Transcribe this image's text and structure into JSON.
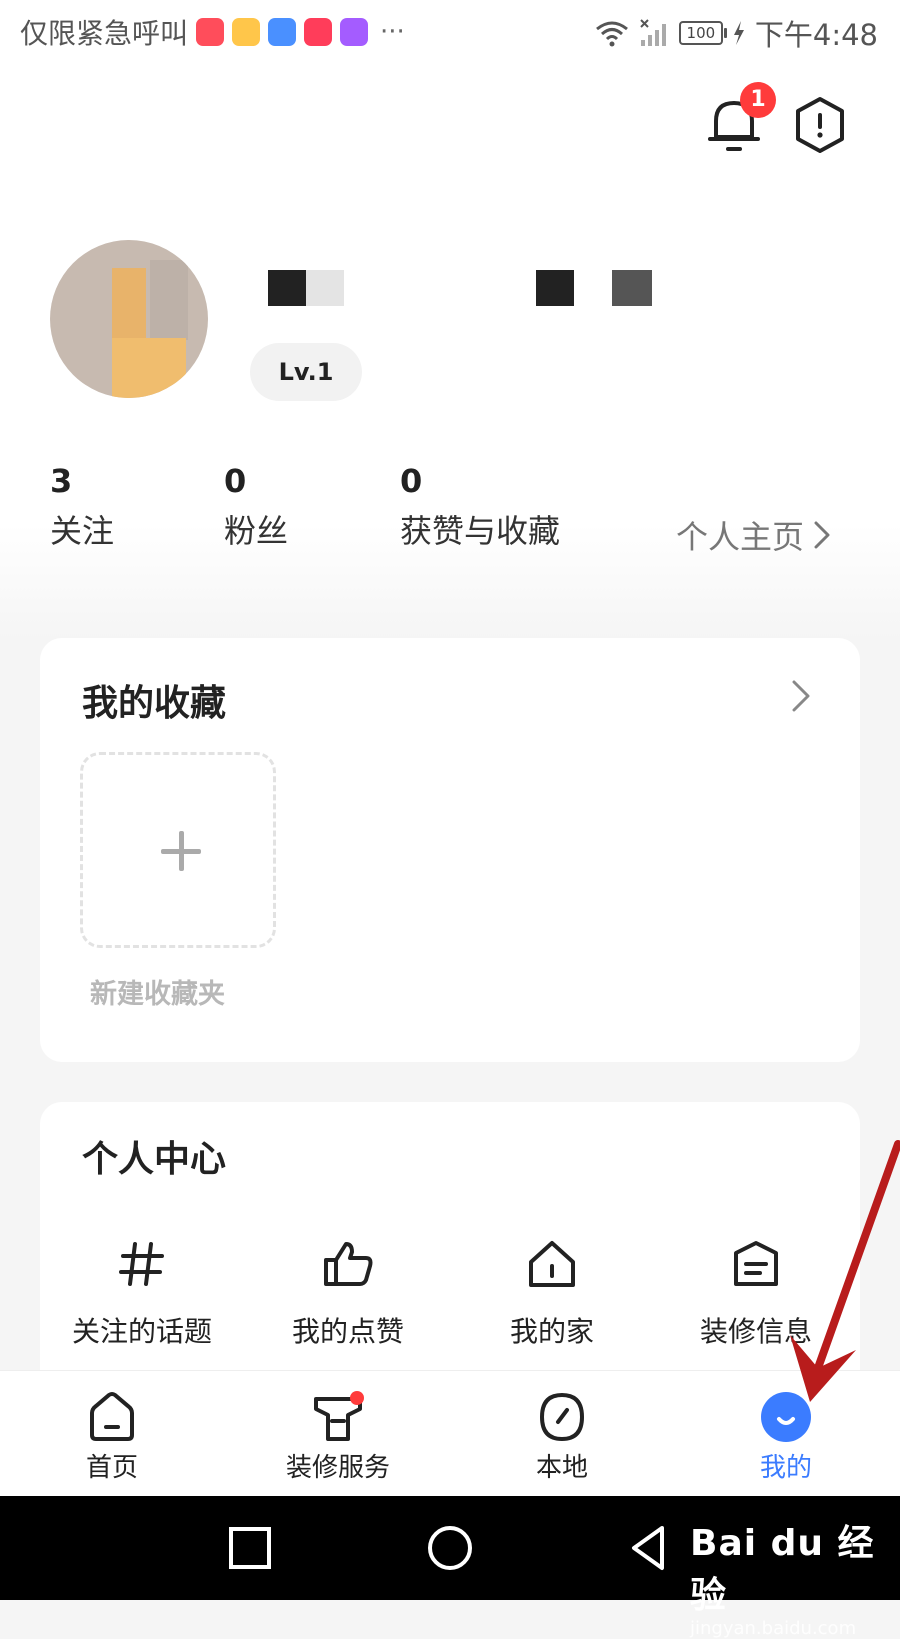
{
  "status_bar": {
    "carrier_text": "仅限紧急呼叫",
    "more": "···",
    "battery": "100",
    "time": "下午4:48",
    "app_icon_colors": [
      "#ff4d5b",
      "#ffc64a",
      "#4a90ff",
      "#ff3d5a",
      "#a45cff"
    ]
  },
  "header": {
    "notification_badge": "1"
  },
  "profile": {
    "level": "Lv.1"
  },
  "stats": {
    "following": {
      "count": "3",
      "label": "关注"
    },
    "followers": {
      "count": "0",
      "label": "粉丝"
    },
    "likes_collections": {
      "count": "0",
      "label": "获赞与收藏"
    },
    "homepage_link": "个人主页"
  },
  "collections": {
    "title": "我的收藏",
    "new_folder_label": "新建收藏夹"
  },
  "personal_center": {
    "title": "个人中心",
    "items": [
      {
        "label": "关注的话题",
        "icon": "hashtag-icon"
      },
      {
        "label": "我的点赞",
        "icon": "thumbs-up-icon"
      },
      {
        "label": "我的家",
        "icon": "home-icon"
      },
      {
        "label": "装修信息",
        "icon": "document-icon"
      }
    ]
  },
  "bottom_nav": {
    "items": [
      {
        "label": "首页",
        "icon": "home-icon",
        "active": false
      },
      {
        "label": "装修服务",
        "icon": "service-icon",
        "active": false,
        "has_dot": true
      },
      {
        "label": "本地",
        "icon": "compass-icon",
        "active": false
      },
      {
        "label": "我的",
        "icon": "profile-face-icon",
        "active": true
      }
    ],
    "active_color": "#3b7cff"
  },
  "watermark": {
    "brand": "Bai du 经验",
    "url": "jingyan.baidu.com"
  },
  "colors": {
    "accent": "#3b7cff",
    "badge": "#ff3b3b",
    "annotation": "#b81c1c"
  }
}
